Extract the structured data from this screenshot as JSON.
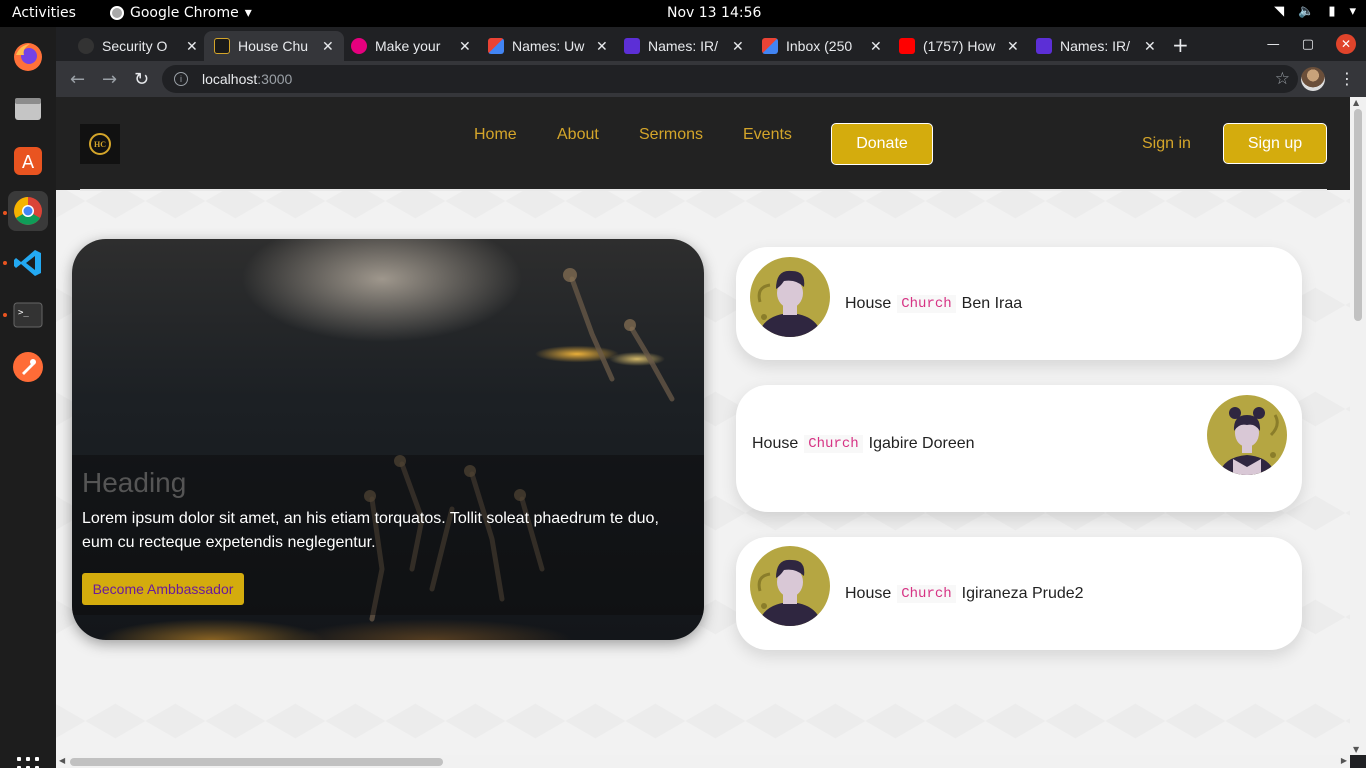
{
  "system": {
    "activities": "Activities",
    "app_name": "Google Chrome",
    "clock": "Nov 13  14:56"
  },
  "browser": {
    "tabs": [
      {
        "title": "Security O",
        "color": "#555555"
      },
      {
        "title": "House Chu",
        "color": "#1a1a1a"
      },
      {
        "title": "Make your",
        "color": "#e6007e"
      },
      {
        "title": "Names: Uw",
        "color": "#ea4335"
      },
      {
        "title": "Names: IR/",
        "color": "#5c2fd6"
      },
      {
        "title": "Inbox (250",
        "color": "#ea4335"
      },
      {
        "title": "(1757) How",
        "color": "#ff0000"
      },
      {
        "title": "Names: IR/",
        "color": "#5c2fd6"
      }
    ],
    "url_host": "localhost",
    "url_port": ":3000"
  },
  "site": {
    "logo_text": "HC",
    "nav": [
      "Home",
      "About",
      "Sermons",
      "Events"
    ],
    "donate_label": "Donate",
    "signin_label": "Sign in",
    "signup_label": "Sign up",
    "accent_color": "#d4ac0d"
  },
  "hero": {
    "heading": "Heading",
    "body": "Lorem ipsum dolor sit amet, an his etiam torquatos. Tollit soleat phaedrum te duo, eum cu recteque expetendis neglegentur.",
    "cta_label": "Become Ambbassador"
  },
  "members": [
    {
      "prefix": "House",
      "code": "Church",
      "name": "Ben Iraa",
      "avatar": "male-avatar"
    },
    {
      "prefix": "House",
      "code": "Church",
      "name": "Igabire Doreen",
      "avatar": "female-avatar"
    },
    {
      "prefix": "House",
      "code": "Church",
      "name": "Igiraneza Prude2",
      "avatar": "male-avatar"
    }
  ]
}
